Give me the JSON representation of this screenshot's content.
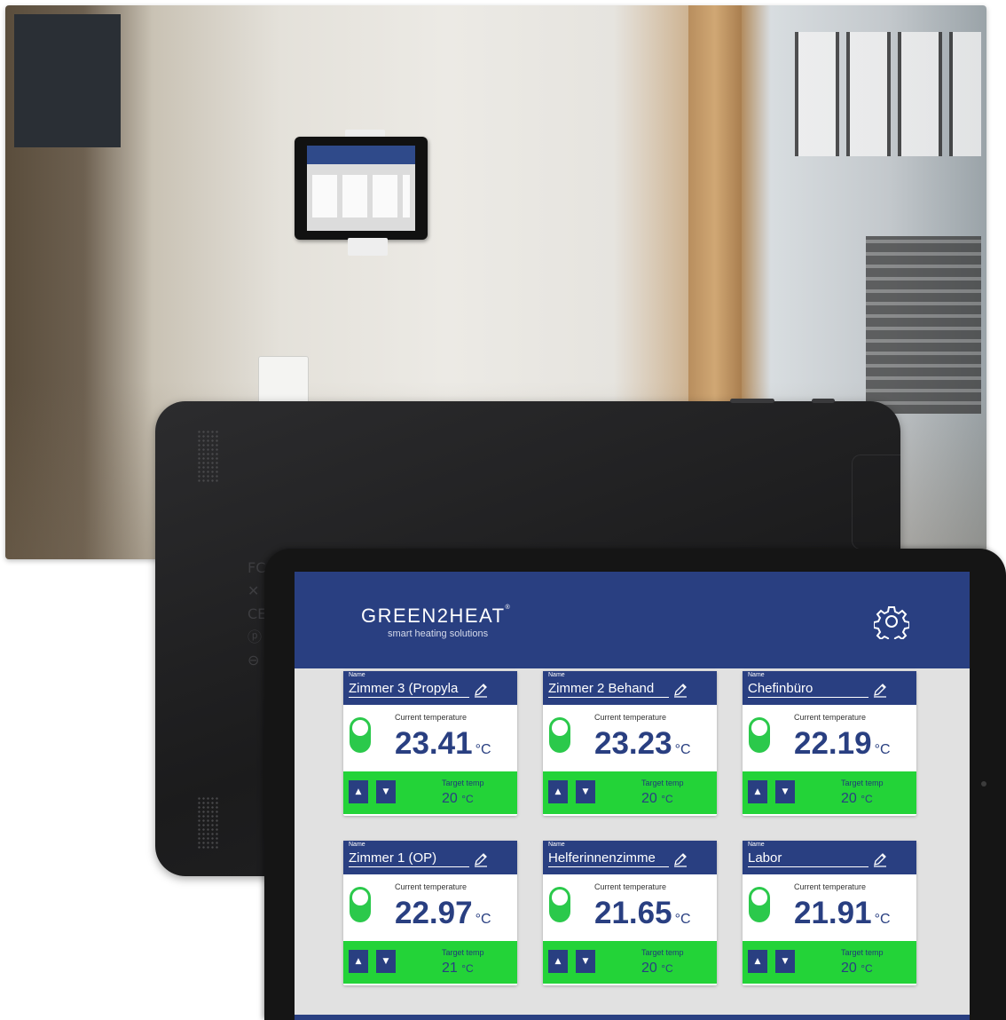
{
  "brand": {
    "name": "GREEN2HEAT",
    "trademark": "®",
    "tagline": "smart heating solutions",
    "header_color": "#293f81",
    "accent_green": "#23d338"
  },
  "back_device": {
    "regulatory_marks": "FC ✕ CE ⓟ ⊖"
  },
  "labels": {
    "name": "Name",
    "current_temperature": "Current temperature",
    "target_temp": "Target temp",
    "unit": "°C"
  },
  "zones": [
    {
      "name": "Zimmer 3 (Propyla",
      "current": "23.41",
      "target": "20",
      "heating_on": true
    },
    {
      "name": "Zimmer 2 Behand",
      "current": "23.23",
      "target": "20",
      "heating_on": true
    },
    {
      "name": "Chefinbüro",
      "current": "22.19",
      "target": "20",
      "heating_on": true
    },
    {
      "name": "Zimmer 1 (OP)",
      "current": "22.97",
      "target": "21",
      "heating_on": true
    },
    {
      "name": "Helferinnenzimme",
      "current": "21.65",
      "target": "20",
      "heating_on": true
    },
    {
      "name": "Labor",
      "current": "21.91",
      "target": "20",
      "heating_on": true
    }
  ],
  "icons": {
    "settings": "gear-icon",
    "edit": "pencil-icon",
    "increase": "arrow-up-icon",
    "decrease": "arrow-down-icon"
  }
}
